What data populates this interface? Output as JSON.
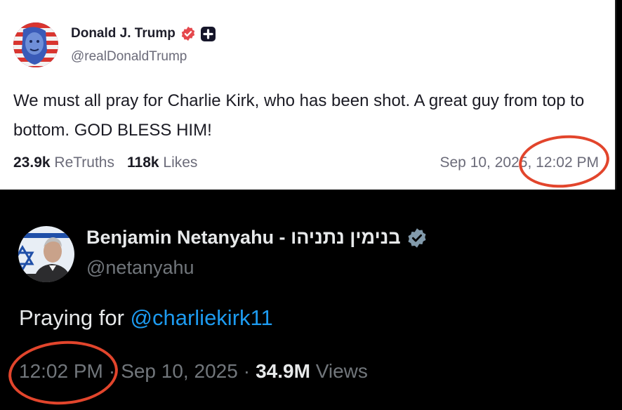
{
  "truth_post": {
    "display_name": "Donald J. Trump",
    "handle": "@realDonaldTrump",
    "body": "We must all pray for Charlie Kirk, who has been shot. A great guy from top to bottom. GOD BLESS HIM!",
    "retruths_count": "23.9k",
    "retruths_label": "ReTruths",
    "likes_count": "118k",
    "likes_label": "Likes",
    "timestamp": "Sep 10, 2025, 12:02 PM",
    "icons": {
      "verified": "verified-badge-icon",
      "plus": "plus-badge-icon"
    },
    "colors": {
      "verified_badge": "#e5484d",
      "background": "#ffffff"
    }
  },
  "x_post": {
    "display_name": "Benjamin Netanyahu - בנימין נתניהו",
    "handle": "@netanyahu",
    "text_prefix": "Praying for ",
    "mention": "@charliekirk11",
    "time": "12:02 PM",
    "separator": "·",
    "date": "Sep 10, 2025",
    "views_count": "34.9M",
    "views_label": "Views",
    "icons": {
      "verified": "verified-badge-icon"
    },
    "colors": {
      "mention": "#1d9bf0",
      "verified_badge": "#829aab",
      "background": "#000000"
    }
  },
  "annotations": {
    "circle_color": "#e2452c"
  }
}
